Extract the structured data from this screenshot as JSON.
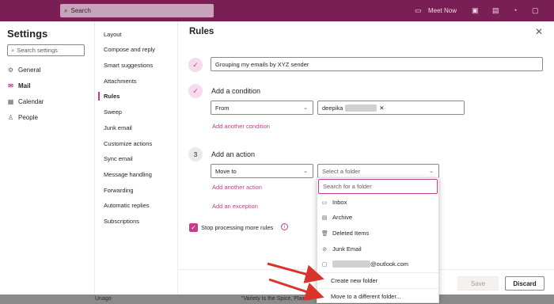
{
  "topbar": {
    "search_placeholder": "Search",
    "meet_now": "Meet Now"
  },
  "settings": {
    "title": "Settings",
    "search_placeholder": "Search settings",
    "nav": [
      {
        "label": "General",
        "icon": "gear-icon"
      },
      {
        "label": "Mail",
        "icon": "mail-icon",
        "active": true
      },
      {
        "label": "Calendar",
        "icon": "calendar-icon"
      },
      {
        "label": "People",
        "icon": "people-icon"
      }
    ]
  },
  "subnav": [
    "Layout",
    "Compose and reply",
    "Smart suggestions",
    "Attachments",
    "Rules",
    "Sweep",
    "Junk email",
    "Customize actions",
    "Sync email",
    "Message handling",
    "Forwarding",
    "Automatic replies",
    "Subscriptions"
  ],
  "rules": {
    "title": "Rules",
    "rule_name": "Grouping my emails by XYZ sender",
    "condition_label": "Add a condition",
    "condition_type": "From",
    "condition_value": "deepika",
    "add_condition": "Add another condition",
    "action_step": "3",
    "action_label": "Add an action",
    "action_type": "Move to",
    "folder_placeholder": "Select a folder",
    "add_action": "Add another action",
    "add_exception": "Add an exception",
    "stop_processing": "Stop processing more rules",
    "save": "Save",
    "discard": "Discard"
  },
  "dropdown": {
    "search_placeholder": "Search for a folder",
    "items": [
      "Inbox",
      "Archive",
      "Deleted Items",
      "Junk Email",
      "@outlook.com",
      "Create new folder",
      "Move to a different folder..."
    ]
  },
  "bottom": {
    "left": "Unago",
    "mid": "\"Variety Is the Spice, Plain ..."
  },
  "colors": {
    "accent": "#c43d8c",
    "topbar": "#7a1f55",
    "arrow": "#d9342b"
  }
}
